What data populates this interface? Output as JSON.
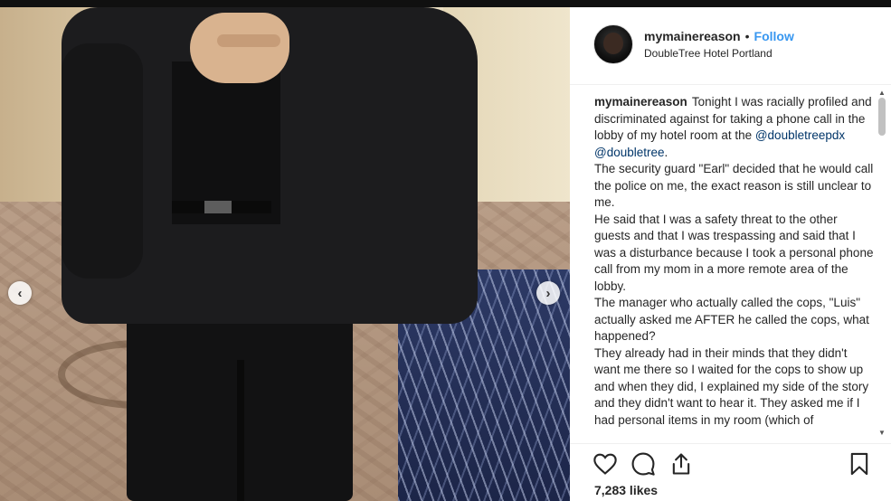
{
  "post": {
    "username": "mymainereason",
    "separator": "•",
    "follow_label": "Follow",
    "location": "DoubleTree Hotel Portland",
    "likes": "7,283 likes"
  },
  "caption": {
    "username": "mymainereason",
    "line1_a": "Tonight I was racially profiled and discriminated against for taking a phone call in the lobby of my hotel room at the ",
    "mention1": "@doubletreepdx",
    "line1_b": " ",
    "mention2": "@doubletree",
    "line1_c": ".",
    "p2": "The security guard \"Earl\" decided that he would call the police on me, the exact reason is still unclear to me.",
    "p3": "He said that I was a safety threat to the other guests and that I was trespassing and said that I was a disturbance because I took a personal phone call from my mom in a more remote area of the lobby.",
    "p4": "The manager who actually called the cops, \"Luis\" actually asked me AFTER he called the cops, what happened?",
    "p5": "They already had in their minds that they didn't want me there so I waited for the cops to show up and when they did, I explained my side of the story and they didn't want to hear it. They asked me if I had personal items in my room (which of"
  },
  "nav": {
    "prev": "‹",
    "next": "›"
  },
  "scrollbar": {
    "up": "▲",
    "down": "▼"
  },
  "icons": {
    "like": "heart-icon",
    "comment": "comment-icon",
    "share": "share-icon",
    "save": "bookmark-icon"
  },
  "colors": {
    "link": "#3897f0",
    "mention": "#003569",
    "text": "#262626"
  }
}
